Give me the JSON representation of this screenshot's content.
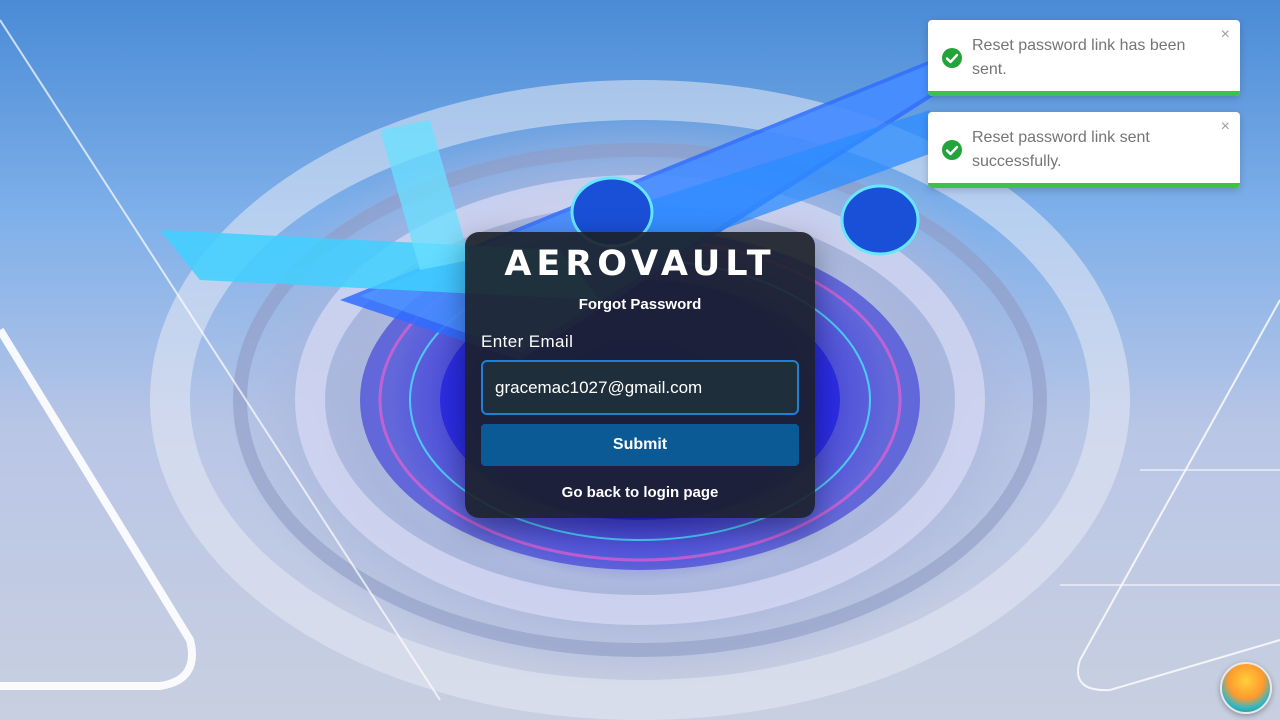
{
  "brand": {
    "name": "AEROVAULT"
  },
  "form": {
    "title": "Forgot Password",
    "email_label": "Enter Email",
    "email_value": "gracemac1027@gmail.com",
    "submit_label": "Submit",
    "back_link": "Go back to login page"
  },
  "toasts": [
    {
      "message": "Reset password link has been sent.",
      "close": "×"
    },
    {
      "message": "Reset password link sent successfully.",
      "close": "×"
    }
  ],
  "colors": {
    "card_bg": "#1c2028",
    "input_border": "#1e7fd6",
    "submit_bg": "#0b5a96",
    "toast_success": "#22a43a",
    "toast_progress": "#3cc24a"
  },
  "icons": {
    "toast_icon": "check-circle-icon",
    "toast_close": "close-icon",
    "floating_app": "island-avatar-icon"
  }
}
